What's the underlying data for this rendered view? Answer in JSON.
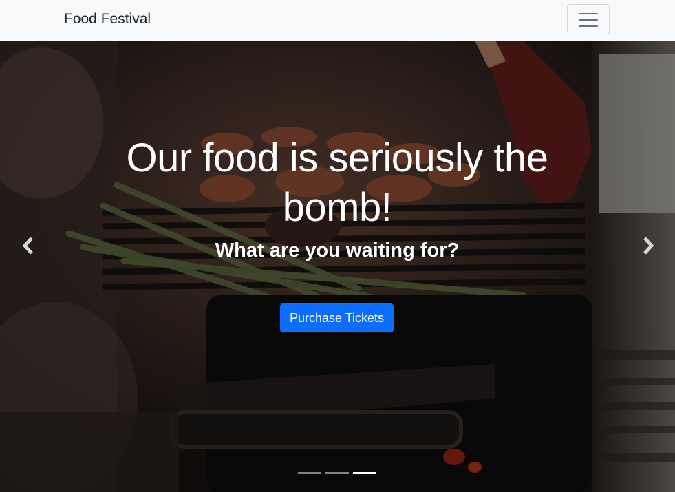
{
  "navbar": {
    "brand": "Food Festival",
    "toggler_icon": "hamburger-menu-icon"
  },
  "hero": {
    "headline": "Our food is seriously the bomb!",
    "subheadline": "What are you waiting for?",
    "cta_label": "Purchase Tickets",
    "cta_color": "#0d6efd",
    "background_description_icon": "grill-photo"
  },
  "carousel": {
    "prev_icon": "chevron-left-icon",
    "next_icon": "chevron-right-icon",
    "slide_count": 3,
    "active_slide": 3
  }
}
